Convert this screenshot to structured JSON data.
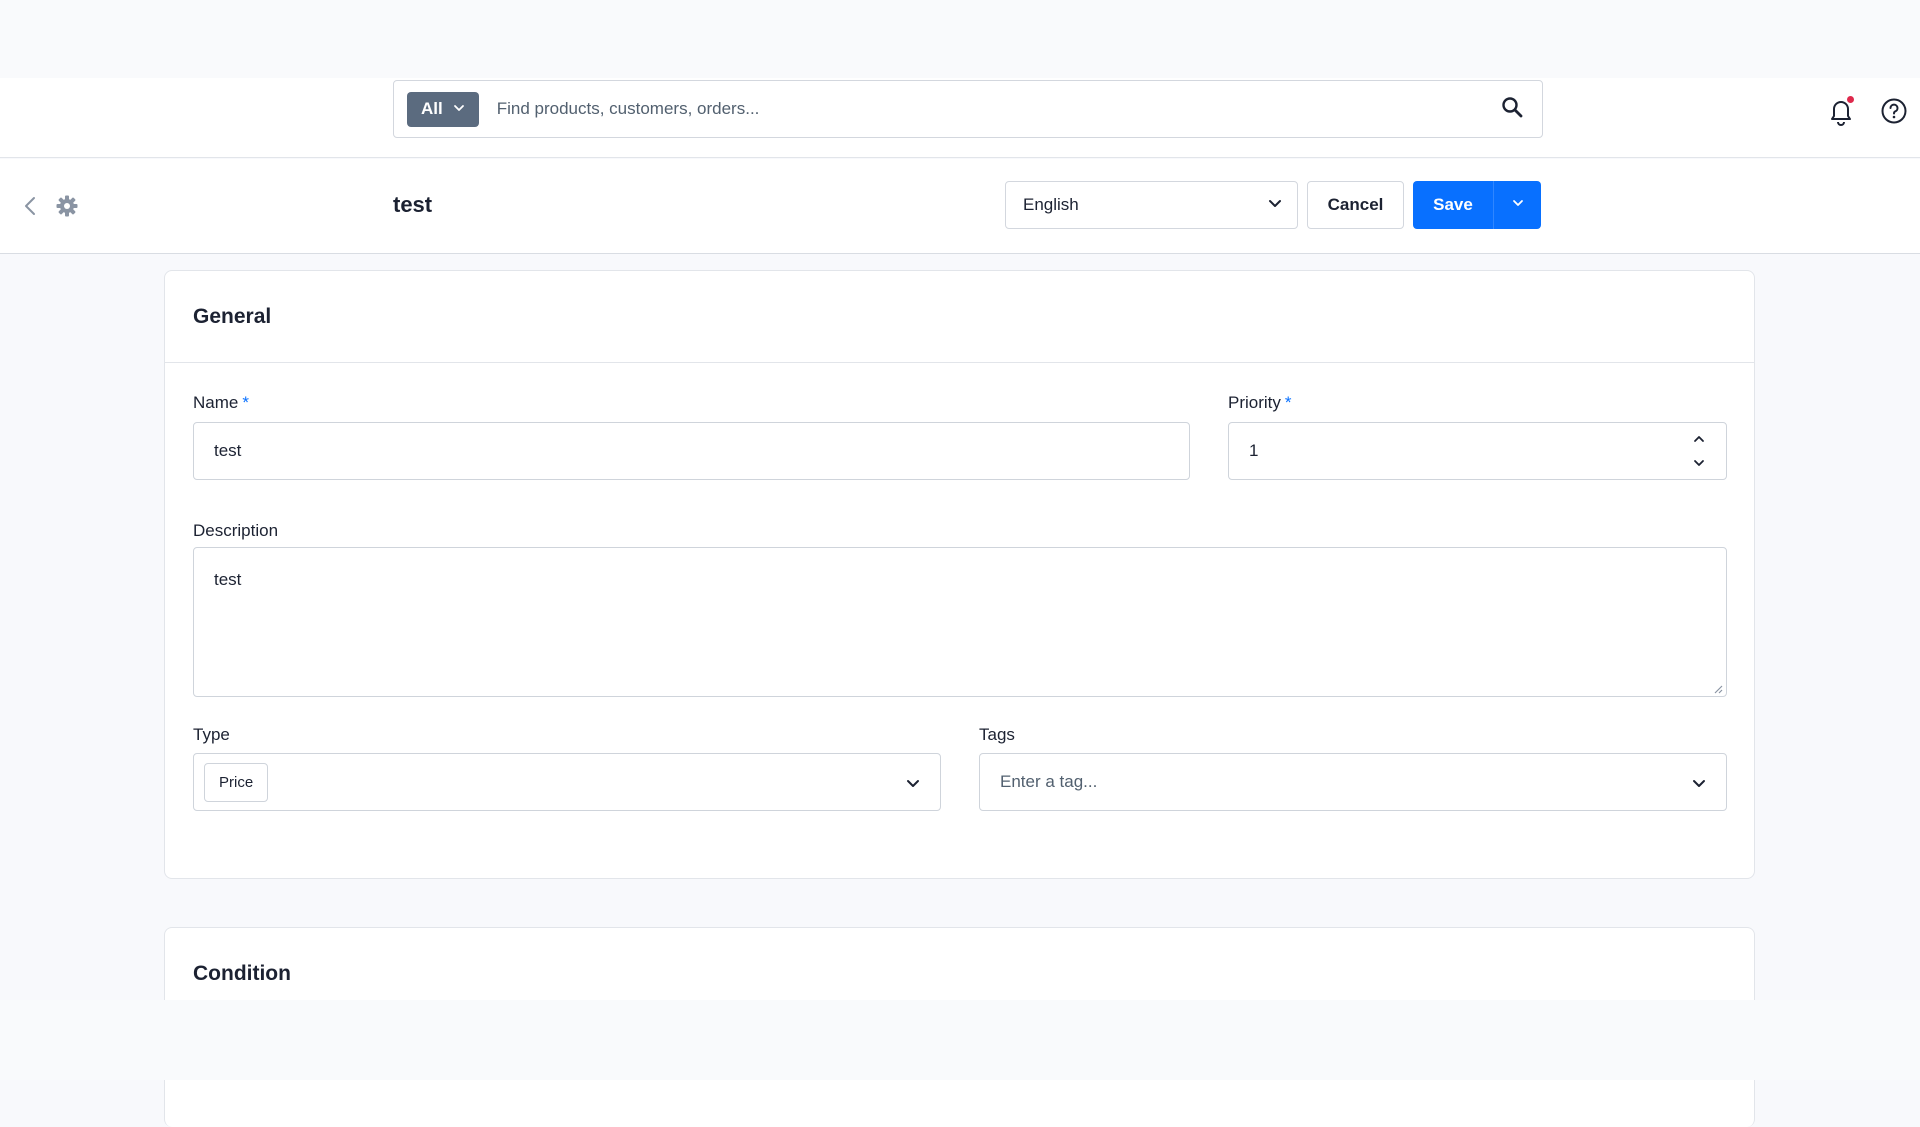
{
  "header": {
    "search_type_label": "All",
    "search_placeholder": "Find products, customers, orders..."
  },
  "smartbar": {
    "title": "test",
    "language": "English",
    "cancel_label": "Cancel",
    "save_label": "Save"
  },
  "general": {
    "title": "General",
    "name_label": "Name",
    "name_value": "test",
    "priority_label": "Priority",
    "priority_value": "1",
    "required_marker": "*",
    "description_label": "Description",
    "description_value": "test",
    "type_label": "Type",
    "type_chip": "Price",
    "tags_label": "Tags",
    "tags_placeholder": "Enter a tag..."
  },
  "condition": {
    "title": "Condition"
  },
  "colors": {
    "primary": "#0870ff",
    "notification_dot": "#de294c",
    "search_type_bg": "#5b6b7f"
  },
  "icons": [
    "chevron-down-icon",
    "search-icon",
    "bell-icon",
    "help-icon",
    "back-arrow-icon",
    "gear-icon",
    "chevron-up-icon"
  ]
}
